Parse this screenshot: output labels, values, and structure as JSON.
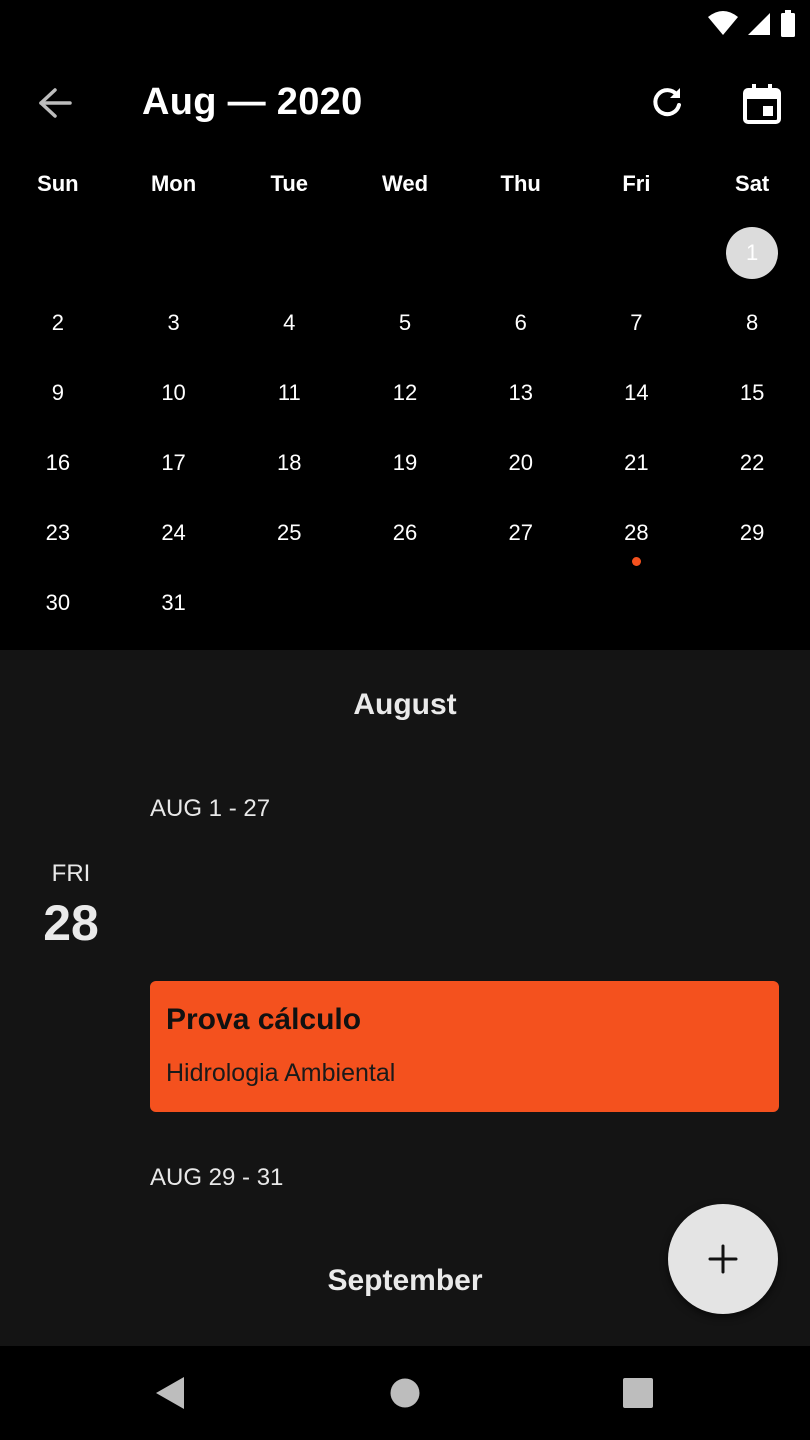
{
  "header": {
    "title": "Aug — 2020",
    "back_icon": "arrow-left-icon",
    "refresh_icon": "refresh-icon",
    "calendar_icon": "calendar-today-icon"
  },
  "calendar": {
    "weekdays": [
      "Sun",
      "Mon",
      "Tue",
      "Wed",
      "Thu",
      "Fri",
      "Sat"
    ],
    "weeks": [
      [
        "",
        "",
        "",
        "",
        "",
        "",
        "1"
      ],
      [
        "2",
        "3",
        "4",
        "5",
        "6",
        "7",
        "8"
      ],
      [
        "9",
        "10",
        "11",
        "12",
        "13",
        "14",
        "15"
      ],
      [
        "16",
        "17",
        "18",
        "19",
        "20",
        "21",
        "22"
      ],
      [
        "23",
        "24",
        "25",
        "26",
        "27",
        "28",
        "29"
      ],
      [
        "30",
        "31",
        "",
        "",
        "",
        "",
        ""
      ]
    ],
    "selected_day": "1",
    "event_days": [
      "28"
    ],
    "event_dot_color": "#f4511e"
  },
  "agenda": {
    "month_august": "August",
    "range_1": "AUG 1 - 27",
    "day": {
      "dow": "FRI",
      "dom": "28"
    },
    "event": {
      "title": "Prova cálculo",
      "subtitle": "Hidrologia Ambiental",
      "color": "#f4511e"
    },
    "range_2": "AUG 29 - 31",
    "month_september": "September"
  },
  "fab": {
    "icon": "plus-icon"
  },
  "nav": {
    "back_icon": "nav-back-icon",
    "home_icon": "nav-home-icon",
    "recents_icon": "nav-recents-icon"
  }
}
